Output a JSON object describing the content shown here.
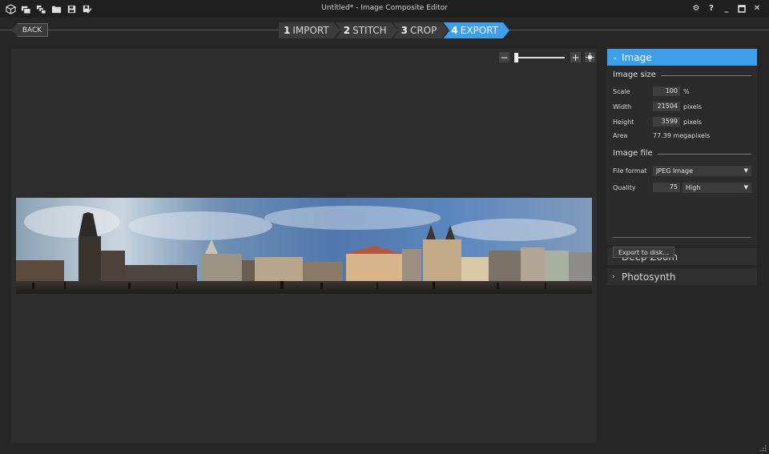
{
  "window": {
    "title": "Untitled* - Image Composite Editor",
    "toolbar_icons": [
      "new-project-icon",
      "new-panorama-icon",
      "new-from-video-icon",
      "open-folder-icon",
      "save-icon",
      "save-as-icon"
    ],
    "settings_glyph": "⚙",
    "help_glyph": "?",
    "minimize_glyph": "_",
    "close_glyph": "✕"
  },
  "nav": {
    "back_label": "BACK",
    "steps": [
      {
        "num": "1",
        "label": "IMPORT",
        "active": false
      },
      {
        "num": "2",
        "label": "STITCH",
        "active": false
      },
      {
        "num": "3",
        "label": "CROP",
        "active": false
      },
      {
        "num": "4",
        "label": "EXPORT",
        "active": true
      }
    ]
  },
  "zoom": {
    "minus_glyph": "−",
    "plus_glyph": "+",
    "level": 0
  },
  "panel": {
    "image": {
      "header": "Image",
      "image_size": {
        "title": "Image size",
        "scale_label": "Scale",
        "scale_value": "100",
        "scale_unit": "%",
        "width_label": "Width",
        "width_value": "21504",
        "width_unit": "pixels",
        "height_label": "Height",
        "height_value": "3599",
        "height_unit": "pixels",
        "area_label": "Area",
        "area_value": "77.39 megapixels"
      },
      "image_file": {
        "title": "Image file",
        "format_label": "File format",
        "format_value": "JPEG Image",
        "quality_label": "Quality",
        "quality_value": "75",
        "quality_preset": "High"
      },
      "export_button": "Export to disk..."
    },
    "deep_zoom": {
      "header": "Deep Zoom"
    },
    "photosynth": {
      "header": "Photosynth"
    }
  },
  "colors": {
    "accent": "#3d9ee9",
    "background": "#262626",
    "canvas": "#2d2d2d"
  }
}
